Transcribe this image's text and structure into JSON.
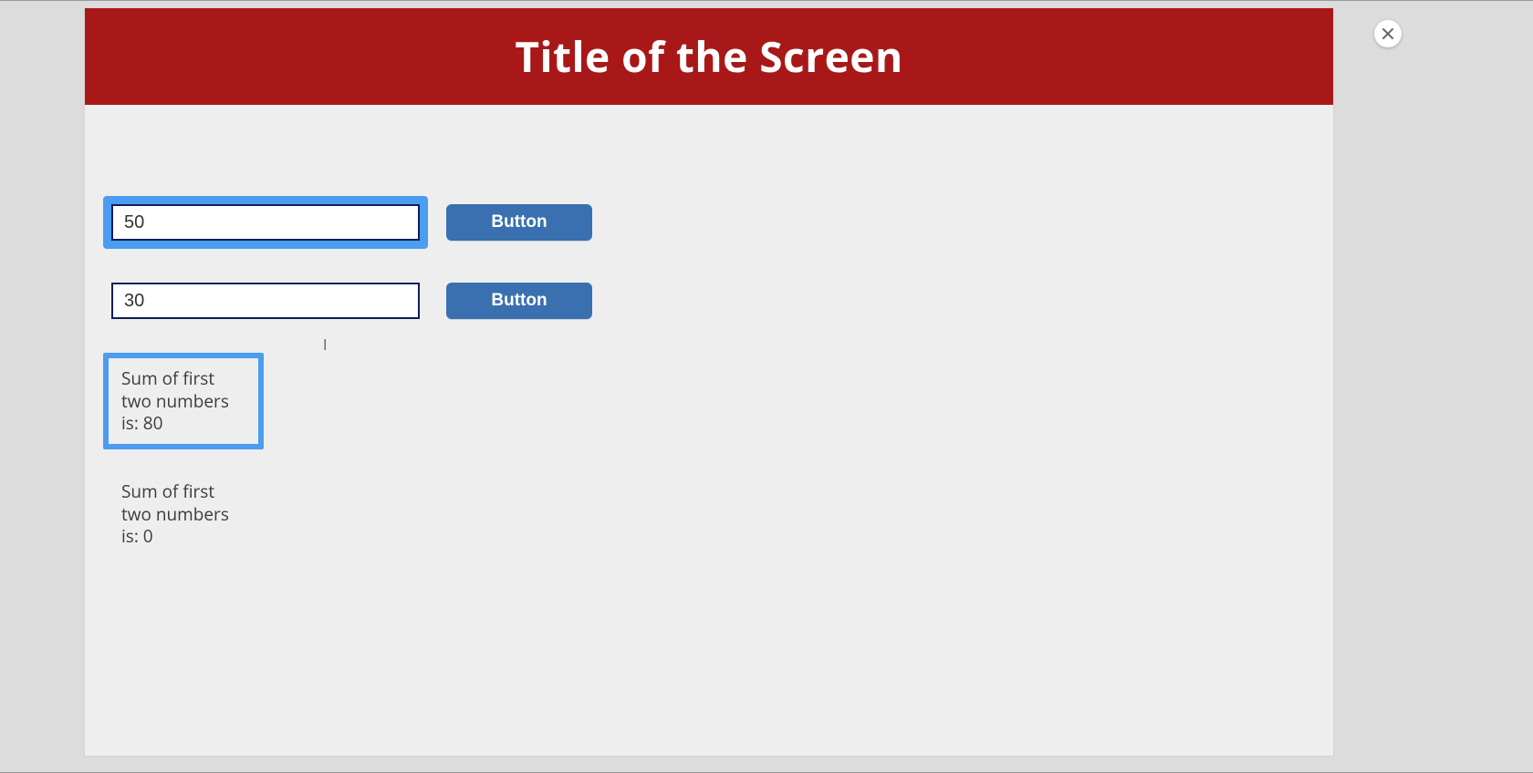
{
  "header": {
    "title": "Title of the Screen"
  },
  "inputs": {
    "first": {
      "value": "50"
    },
    "second": {
      "value": "30"
    }
  },
  "buttons": {
    "first": "Button",
    "second": "Button"
  },
  "results": {
    "primary": "Sum of first two numbers is: 80",
    "secondary": "Sum of first two numbers is: 0"
  },
  "icons": {
    "close": "close-icon"
  },
  "highlights": {
    "input1": true,
    "input2": false,
    "result1": true,
    "result2": false
  }
}
